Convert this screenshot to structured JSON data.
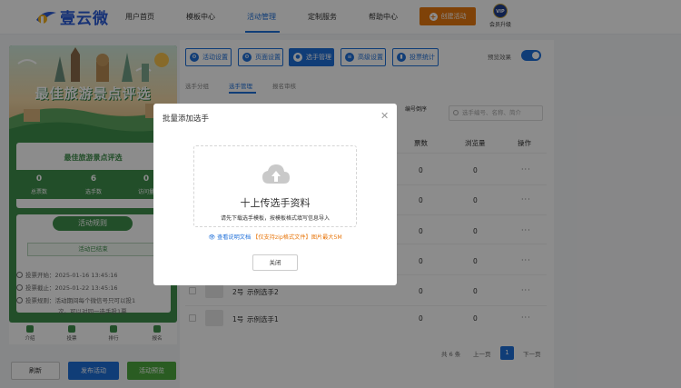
{
  "brand": {
    "name": "壹云微"
  },
  "nav": {
    "items": [
      "用户首页",
      "模板中心",
      "活动管理",
      "定制服务",
      "帮助中心"
    ],
    "active_index": 2,
    "create_label": "创建活动",
    "vip_badge": "VIP",
    "vip_label": "会员升级"
  },
  "preview": {
    "poster_title": "最佳旅游景点评选",
    "subtitle": "最佳旅游景点评选",
    "stats": [
      {
        "value": "0",
        "label": "总票数"
      },
      {
        "value": "6",
        "label": "选手数"
      },
      {
        "value": "0",
        "label": "访问量"
      }
    ],
    "rules_title": "活动规则",
    "status": "活动已结束",
    "rules": [
      "投票开始：2025-01-16 13:45:16",
      "投票截止：2025-01-22 13:45:16",
      "投票规则：活动期间每个微信号只可以投1",
      "次。可以对同一选手投1票"
    ],
    "tabs": [
      "介绍",
      "投票",
      "排行",
      "报名"
    ],
    "refresh_label": "刷新",
    "publish_label": "发布活动",
    "preview_label": "活动预览"
  },
  "toolbar": {
    "buttons": [
      "活动设置",
      "页面设置",
      "选手管理",
      "高级设置",
      "投票统计"
    ],
    "active_index": 2,
    "preview_toggle_label": "预览效果",
    "preview_toggle_on": true
  },
  "subtabs": {
    "items": [
      "选手分组",
      "选手管理",
      "报名审核"
    ],
    "active_index": 1
  },
  "filters": {
    "sort_label": "编号倒序",
    "search_placeholder": "选手编号、名称、简介"
  },
  "table": {
    "headers": [
      "票数",
      "浏览量",
      "操作"
    ],
    "rows": [
      {
        "no": "",
        "name": "",
        "votes": "0",
        "views": "0",
        "action": "···"
      },
      {
        "no": "",
        "name": "",
        "votes": "0",
        "views": "0",
        "action": "···"
      },
      {
        "no": "",
        "name": "",
        "votes": "0",
        "views": "0",
        "action": "···"
      },
      {
        "no": "",
        "name": "",
        "votes": "0",
        "views": "0",
        "action": "···"
      },
      {
        "no": "2号",
        "name": "示例选手2",
        "votes": "0",
        "views": "0",
        "action": "···"
      },
      {
        "no": "1号",
        "name": "示例选手1",
        "votes": "0",
        "views": "0",
        "action": "···"
      }
    ]
  },
  "pagination": {
    "total": "共 6 条",
    "prev": "上一页",
    "current": "1",
    "next": "下一页"
  },
  "modal": {
    "title": "批量添加选手",
    "upload_title": "十上传选手资料",
    "upload_desc": "请先下载选手模板，按模板格式填写信息导入",
    "help_link": "查看说明文档",
    "help_note": "【仅支持zip格式文件】图片最大5M",
    "close_label": "关闭"
  },
  "colors": {
    "primary": "#1e6fd9",
    "accent": "#e8780f",
    "preview_green": "#3f8e4c"
  }
}
